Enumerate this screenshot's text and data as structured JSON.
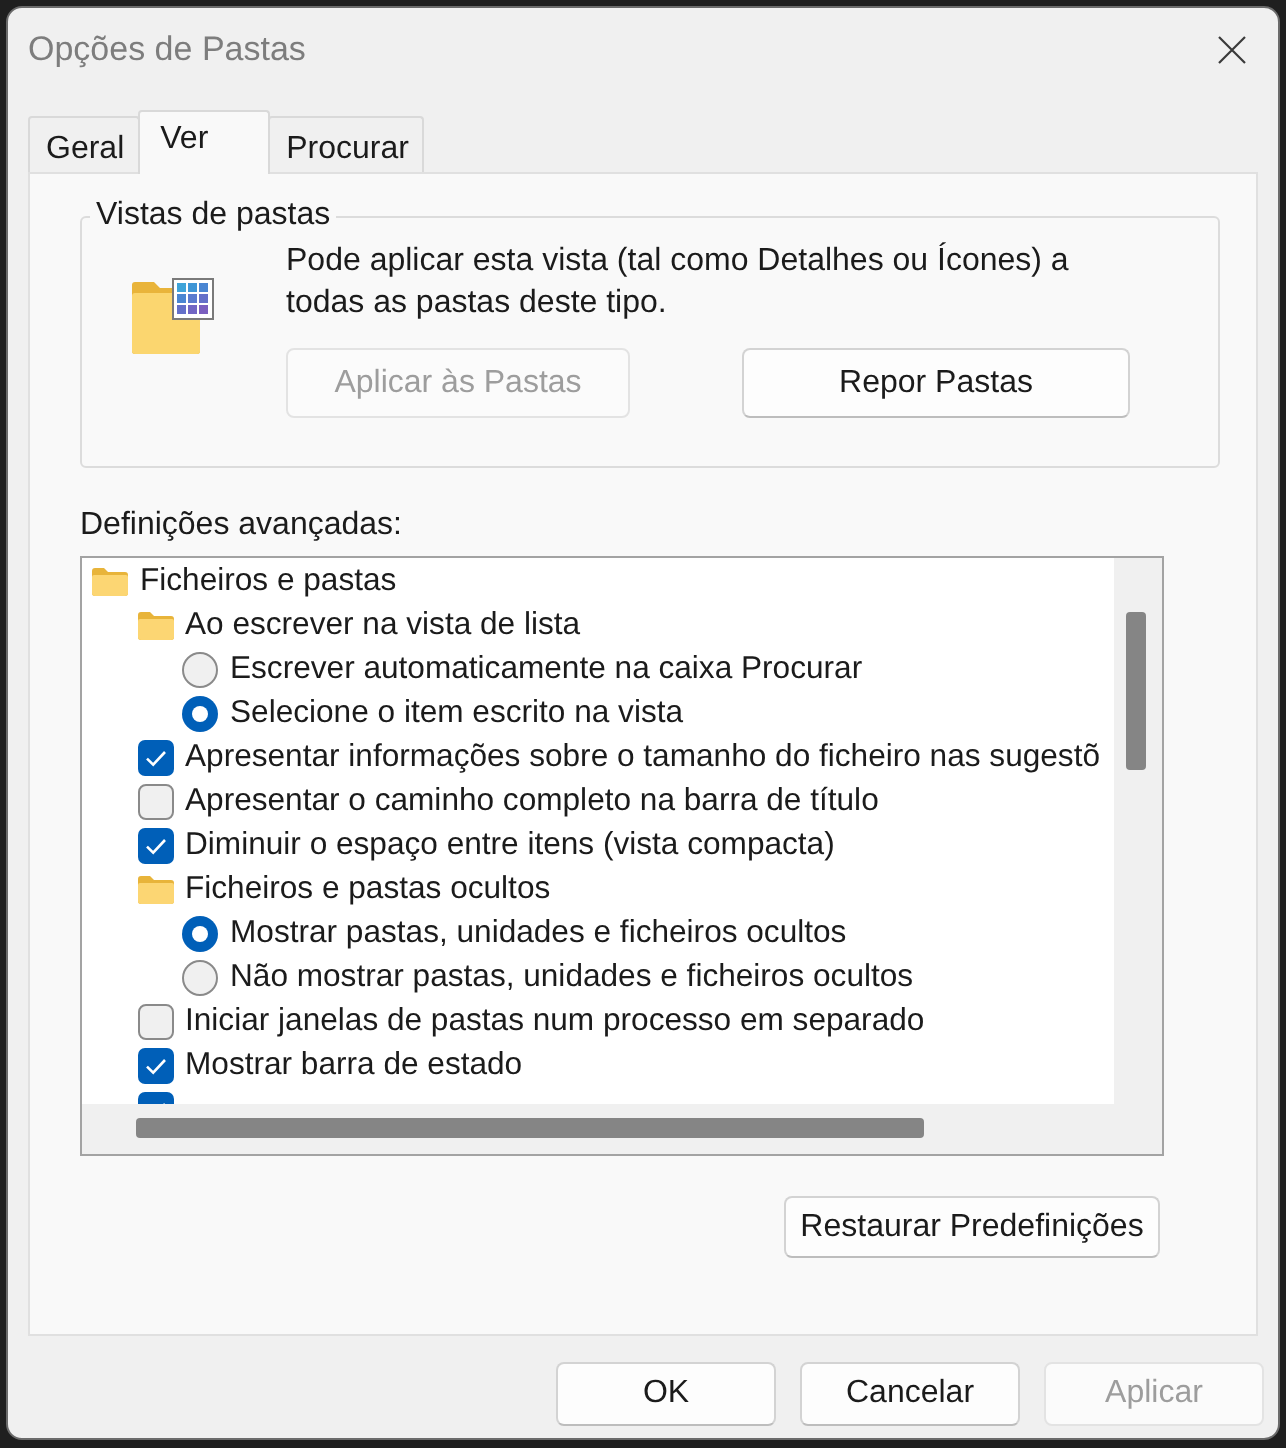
{
  "window": {
    "title": "Opções de Pastas"
  },
  "tabs": [
    {
      "label": "Geral",
      "selected": false
    },
    {
      "label": "Ver",
      "selected": true
    },
    {
      "label": "Procurar",
      "selected": false
    }
  ],
  "folder_views": {
    "title": "Vistas de pastas",
    "description": "Pode aplicar esta vista (tal como Detalhes ou Ícones) a todas as pastas deste tipo.",
    "buttons": [
      {
        "label": "Aplicar às Pastas",
        "disabled": true
      },
      {
        "label": "Repor Pastas",
        "disabled": false
      }
    ]
  },
  "advanced_settings": {
    "label": "Definições avançadas:",
    "items": [
      {
        "kind": "folder",
        "label": "Ficheiros e pastas",
        "children": [
          {
            "kind": "folder",
            "label": "Ao escrever na vista de lista",
            "children": [
              {
                "kind": "radio",
                "label": "Escrever automaticamente na caixa Procurar",
                "selected": false
              },
              {
                "kind": "radio",
                "label": "Selecione o item escrito na vista",
                "selected": true
              }
            ]
          },
          {
            "kind": "checkbox",
            "label": "Apresentar informações sobre o tamanho do ficheiro nas sugestõ",
            "checked": true
          },
          {
            "kind": "checkbox",
            "label": "Apresentar o caminho completo na barra de título",
            "checked": false
          },
          {
            "kind": "checkbox",
            "label": "Diminuir o espaço entre itens (vista compacta)",
            "checked": true
          },
          {
            "kind": "folder",
            "label": "Ficheiros e pastas ocultos",
            "children": [
              {
                "kind": "radio",
                "label": "Mostrar pastas, unidades e ficheiros ocultos",
                "selected": true
              },
              {
                "kind": "radio",
                "label": "Não mostrar pastas, unidades e ficheiros ocultos",
                "selected": false
              }
            ]
          },
          {
            "kind": "checkbox",
            "label": "Iniciar janelas de pastas num processo em separado",
            "checked": false
          },
          {
            "kind": "checkbox",
            "label": "Mostrar barra de estado",
            "checked": true
          },
          {
            "kind": "checkbox",
            "checked": true
          }
        ]
      }
    ],
    "restore_button": {
      "label": "Restaurar Predefinições",
      "disabled": false
    }
  },
  "buttons": [
    {
      "label": "OK",
      "disabled": false
    },
    {
      "label": "Cancelar",
      "disabled": false
    },
    {
      "label": "Aplicar",
      "disabled": true
    }
  ]
}
